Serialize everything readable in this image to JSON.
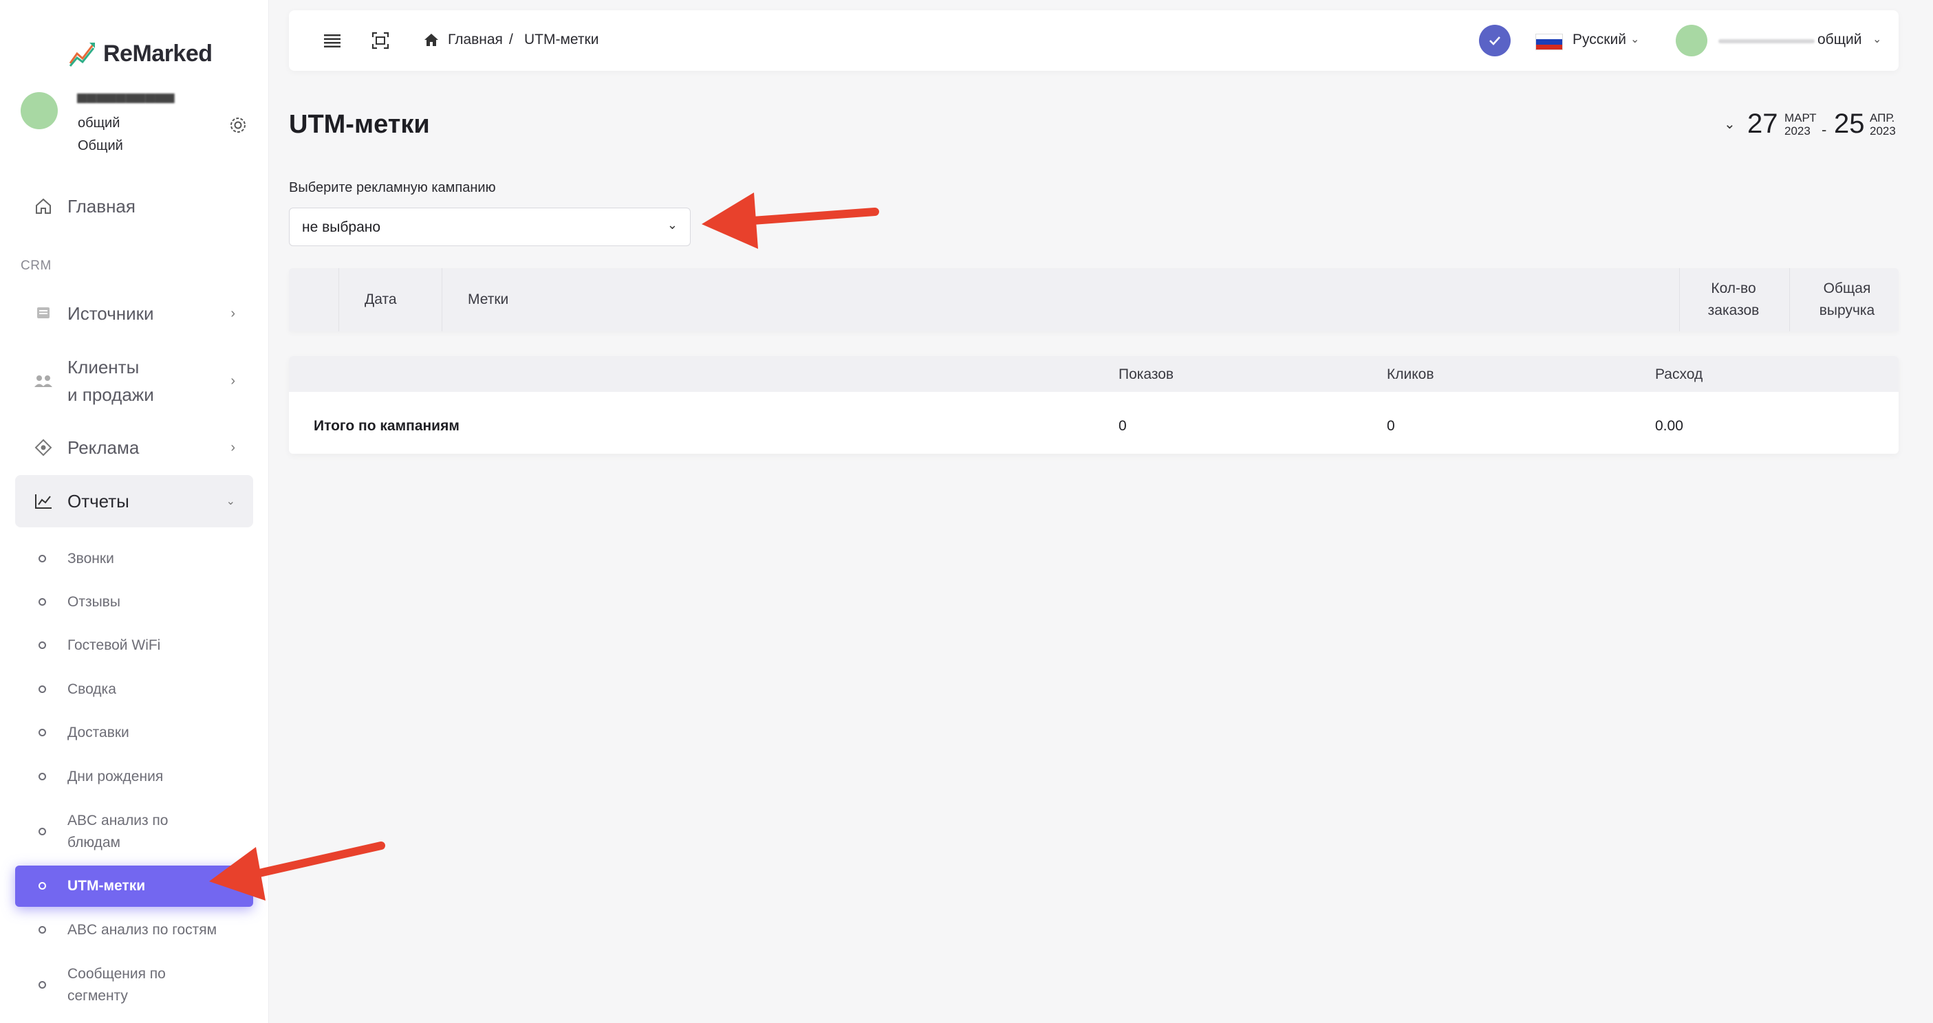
{
  "app": {
    "logo_text": "ReMarked"
  },
  "sidebar": {
    "user": {
      "role": "общий",
      "group": "Общий"
    },
    "home_label": "Главная",
    "section_crm": "CRM",
    "items": [
      {
        "label": "Источники"
      },
      {
        "label_line1": "Клиенты",
        "label_line2": "и продажи"
      },
      {
        "label": "Реклама"
      },
      {
        "label": "Отчеты"
      }
    ],
    "reports": [
      {
        "label": "Звонки"
      },
      {
        "label": "Отзывы"
      },
      {
        "label": "Гостевой WiFi"
      },
      {
        "label": "Сводка"
      },
      {
        "label": "Доставки"
      },
      {
        "label": "Дни рождения"
      },
      {
        "label_line1": "ABC анализ по",
        "label_line2": "блюдам"
      },
      {
        "label": "UTM-метки"
      },
      {
        "label": "ABC анализ по гостям"
      },
      {
        "label_line1": "Сообщения по",
        "label_line2": "сегменту"
      }
    ],
    "active_item": "UTM-метки"
  },
  "topbar": {
    "breadcrumb_home": "Главная",
    "breadcrumb_sep": "/",
    "breadcrumb_current": "UTM-метки",
    "language": "Русский",
    "user_role": "общий"
  },
  "page": {
    "title": "UTM-метки",
    "date_from": {
      "day": "27",
      "month": "МАРТ",
      "year": "2023"
    },
    "date_sep": "-",
    "date_to": {
      "day": "25",
      "month": "АПР.",
      "year": "2023"
    }
  },
  "campaign_select": {
    "label": "Выберите рекламную кампанию",
    "value": "не выбрано"
  },
  "utm_table": {
    "headers": {
      "date": "Дата",
      "tags": "Метки",
      "orders_line1": "Кол-во",
      "orders_line2": "заказов",
      "revenue_line1": "Общая",
      "revenue_line2": "выручка"
    }
  },
  "totals_table": {
    "headers": {
      "impressions": "Показов",
      "clicks": "Кликов",
      "spend": "Расход"
    },
    "row": {
      "label": "Итого по кампаниям",
      "impressions": "0",
      "clicks": "0",
      "spend": "0.00"
    }
  },
  "colors": {
    "accent": "#7367f0",
    "verified_badge": "#5a63c6",
    "annotation_arrow": "#e8412c"
  }
}
